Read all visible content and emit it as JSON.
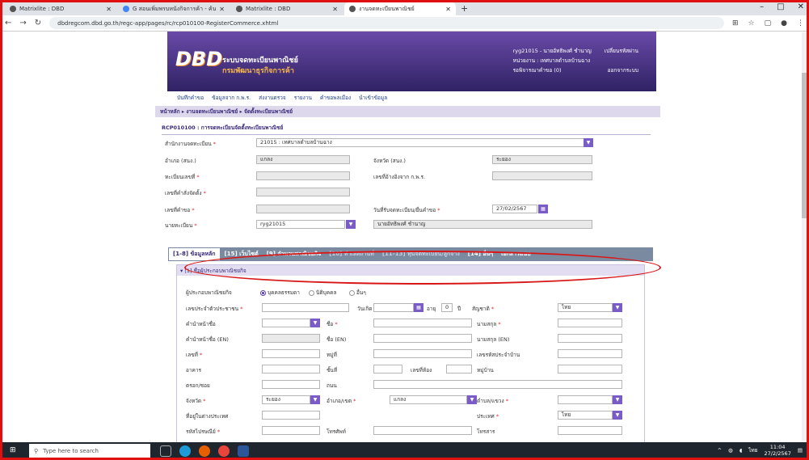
{
  "browser": {
    "tabs": [
      {
        "label": "Matrixlite : DBD"
      },
      {
        "label": "G  สอนเพิ่มพรบหนังกิจการค้า - ค้นหาด้วย Google"
      },
      {
        "label": "Matrixlite : DBD"
      },
      {
        "label": "งานจดทะเบียนพาณิชย์"
      }
    ],
    "active_tab": 3,
    "new_tab": "+",
    "url": "dbdregcom.dbd.go.th/regc-app/pages/rc/rcp010100-RegisterCommerce.xhtml",
    "window_controls": [
      "–",
      "□",
      "✕"
    ]
  },
  "header": {
    "logo": "DBD",
    "brand_line1": "ระบบจดทะเบียนพาณิชย์",
    "brand_line2": "กรมพัฒนาธุรกิจการค้า",
    "user": "ryg21015 - นายอัทธิพงศ์ ชำนาญ",
    "change_password": "เปลี่ยนรหัสผ่าน",
    "office": "หน่วยงาน : เทศบาลตำบลบ้านฉาง",
    "pending": "รอพิจารณาคำขอ (0)",
    "logout": "ออกจากระบบ"
  },
  "menu": [
    "บันทึกคำขอ",
    "ข้อมูลจาก ก.พ.ร.",
    "ส่งงานตรวจ",
    "รายงาน",
    "คำขอพลเมือง",
    "นำเข้าข้อมูล"
  ],
  "breadcrumb": "หน้าหลัก ▸ งานจดทะเบียนพาณิชย์ ▸ จัดตั้งทะเบียนพาณิชย์",
  "page_title": "RCP010100 : การจดทะเบียนจัดตั้งทะเบียนพาณิชย์",
  "form": {
    "office_label": "สำนักงานจดทะเบียน",
    "office_value": "21015 : เทศบาลตำบลบ้านฉาง",
    "amphoe_label": "อำเภอ (สนง.)",
    "amphoe_value": "แกลง",
    "province_label": "จังหวัด (สนง.)",
    "province_value": "ระยอง",
    "regno_label": "ทะเบียนเลขที่",
    "ref_label": "เลขที่อ้างอิงจาก ก.พ.ร.",
    "order_label": "เลขที่คำสั่งจัดตั้ง",
    "reqno_label": "เลขที่คำขอ",
    "date_label": "วันที่รับจดทะเบียน/ยื่นคำขอ",
    "date_value": "27/02/2567",
    "registrar_label": "นายทะเบียน",
    "registrar_code": "ryg21015",
    "registrar_name": "นายอัทธิพงศ์ ชำนาญ"
  },
  "form_tabs": [
    "[1-8] ข้อมูลหลัก",
    "[15] เว็บไซต์",
    "[9] จำนวนพาณิชยกิจ",
    "[10] ทำเลสถานที่",
    "[11-13] ทุนจดทะเบียน/ลูกจ้าง",
    "[14] อื่นๆ",
    "เอกสารแนบ"
  ],
  "section": {
    "title": "[1] ชื่อผู้ประกอบพาณิชยกิจ",
    "type_label": "ผู้ประกอบพาณิชยกิจ",
    "type_options": [
      "บุคคลธรรมดา",
      "นิติบุคคล",
      "อื่นๆ"
    ],
    "id_label": "เลขประจำตัวประชาชน",
    "birth_label": "วันเกิด",
    "age_label": "อายุ",
    "age_value": "0",
    "age_unit": "ปี",
    "nationality_label": "สัญชาติ",
    "nationality_value": "ไทย",
    "prefix_label": "คำนำหน้าชื่อ",
    "fname_label": "ชื่อ",
    "lname_label": "นามสกุล",
    "prefix_en_label": "คำนำหน้าชื่อ (EN)",
    "fname_en_label": "ชื่อ (EN)",
    "lname_en_label": "นามสกุล (EN)",
    "house_label": "เลขที่",
    "moo_label": "หมู่ที่",
    "house_code_label": "เลขรหัสประจำบ้าน",
    "building_label": "อาคาร",
    "floor_label": "ชั้นที่",
    "room_label": "เลขที่ห้อง",
    "village_label": "หมู่บ้าน",
    "soi_label": "ตรอก/ซอย",
    "road_label": "ถนน",
    "prov_label": "จังหวัด",
    "prov_value": "ระยอง",
    "district_label": "อำเภอ/เขต",
    "district_value": "แกลง",
    "subdistrict_label": "ตำบล/แขวง",
    "abroad_label": "ที่อยู่ในต่างประเทศ",
    "country_label": "ประเทศ",
    "country_value": "ไทย",
    "postcode_label": "รหัสไปรษณีย์",
    "phone_label": "โทรศัพท์",
    "fax_label": "โทรสาร"
  },
  "taskbar": {
    "search_placeholder": "Type here to search",
    "time": "11:04",
    "date": "27/2/2567",
    "lang": "ไทย"
  }
}
